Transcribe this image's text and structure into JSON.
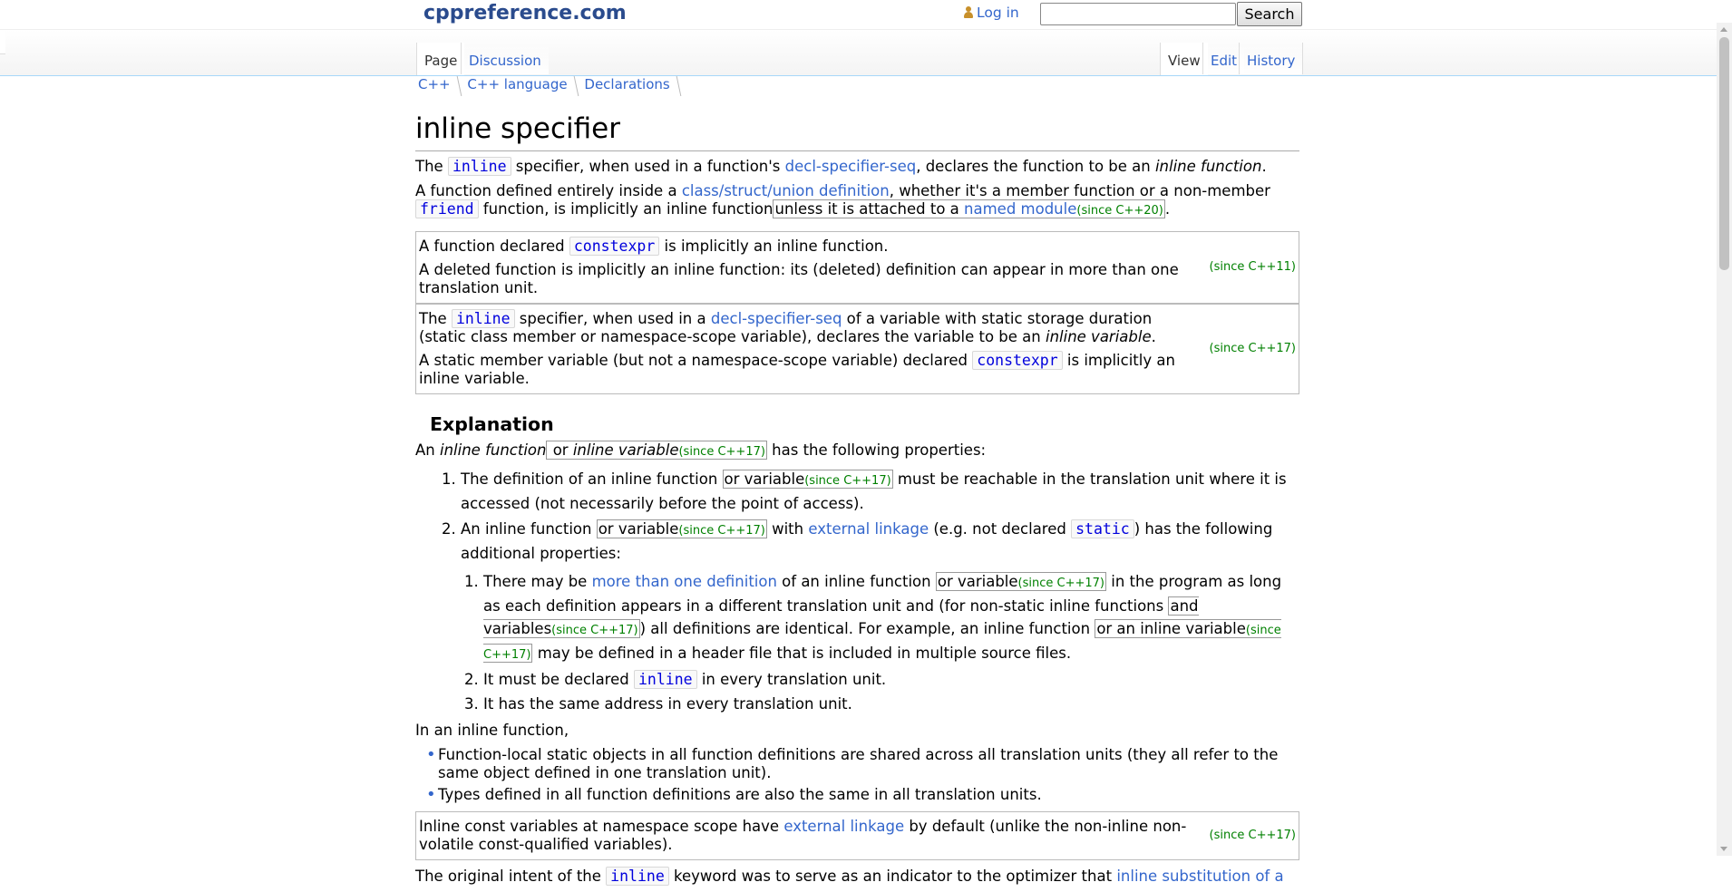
{
  "header": {
    "site_name": "cppreference.com",
    "login": "Log in",
    "search_placeholder": "",
    "search_button": "Search"
  },
  "tabs": {
    "page": "Page",
    "discussion": "Discussion",
    "view": "View",
    "edit": "Edit",
    "history": "History"
  },
  "breadcrumb": [
    "C++",
    "C++ language",
    "Declarations"
  ],
  "title": "inline specifier",
  "intro": {
    "p1_a": "The ",
    "p1_code": "inline",
    "p1_b": " specifier, when used in a function's ",
    "p1_link": "decl-specifier-seq",
    "p1_c": ", declares the function to be an ",
    "p1_em": "inline function",
    "p1_d": ".",
    "p2_a": "A function defined entirely inside a ",
    "p2_link": "class/struct/union definition",
    "p2_b": ", whether it's a member function or a non-member ",
    "p2_code": "friend",
    "p2_c": " function, is implicitly an inline function",
    "p2_rev_a": "unless it is attached to a ",
    "p2_rev_link": "named module",
    "p2_since": "(since C++20)",
    "p2_d": "."
  },
  "rev11": {
    "a1": "A function declared ",
    "code": "constexpr",
    "a2": " is implicitly an inline function.",
    "b": "A deleted function is implicitly an inline function: its (deleted) definition can appear in more than one translation unit.",
    "since": "(since C++11)"
  },
  "rev17": {
    "a1": "The ",
    "code1": "inline",
    "a2": " specifier, when used in a ",
    "link": "decl-specifier-seq",
    "a3": " of a variable with static storage duration (static class member or namespace-scope variable), declares the variable to be an ",
    "em": "inline variable",
    "a4": ".",
    "b1": "A static member variable (but not a namespace-scope variable) declared ",
    "code2": "constexpr",
    "b2": " is implicitly an inline variable.",
    "since": "(since C++17)"
  },
  "explanation": {
    "heading": "Explanation",
    "lead_a": "An ",
    "lead_em1": "inline function",
    "lead_rev_a": " or ",
    "lead_em2": "inline variable",
    "lead_since": "(since C++17)",
    "lead_b": " has the following properties:",
    "li1_a": "The definition of an inline function ",
    "li1_rev": "or variable",
    "li1_since": "(since C++17)",
    "li1_b": " must be reachable in the translation unit where it is accessed (not necessarily before the point of access).",
    "li2_a": "An inline function ",
    "li2_rev": "or variable",
    "li2_since": "(since C++17)",
    "li2_b": " with ",
    "li2_link": "external linkage",
    "li2_c": " (e.g. not declared ",
    "li2_code": "static",
    "li2_d": ") has the following additional properties:",
    "sub1_a": "There may be ",
    "sub1_link": "more than one definition",
    "sub1_b": " of an inline function ",
    "sub1_rev1": "or variable",
    "sub1_since1": "(since C++17)",
    "sub1_c": " in the program as long as each definition appears in a different translation unit and (for non-static inline functions ",
    "sub1_rev2": "and variables",
    "sub1_since2": "(since C++17)",
    "sub1_d": ") all definitions are identical. For example, an inline function ",
    "sub1_rev3": "or an inline variable",
    "sub1_since3": "(since C++17)",
    "sub1_e": " may be defined in a header file that is included in multiple source files.",
    "sub2_a": "It must be declared ",
    "sub2_code": "inline",
    "sub2_b": " in every translation unit.",
    "sub3": "It has the same address in every translation unit.",
    "inline_fn": "In an inline function,",
    "bullet1": "Function-local static objects in all function definitions are shared across all translation units (they all refer to the same object defined in one translation unit).",
    "bullet2": "Types defined in all function definitions are also the same in all translation units.",
    "rev_box_a": "Inline const variables at namespace scope have ",
    "rev_box_link": "external linkage",
    "rev_box_b": " by default (unlike the non-inline non-volatile const-qualified variables).",
    "rev_box_since": "(since C++17)",
    "last_a": "The original intent of the ",
    "last_code": "inline",
    "last_b": " keyword was to serve as an indicator to the optimizer that ",
    "last_link": "inline substitution of a"
  },
  "colors": {
    "link": "#3366cc",
    "since": "#008000",
    "code": "#0000dd"
  }
}
